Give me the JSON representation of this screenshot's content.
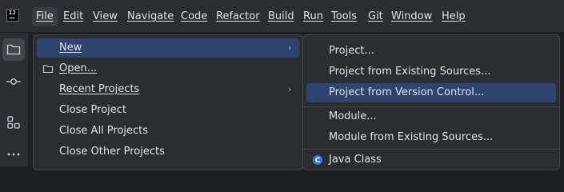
{
  "menubar": {
    "items": [
      "File",
      "Edit",
      "View",
      "Navigate",
      "Code",
      "Refactor",
      "Build",
      "Run",
      "Tools",
      "Git",
      "Window",
      "Help"
    ],
    "active": "File"
  },
  "toolstrip": {
    "icons": [
      "project-folder-icon",
      "commit-icon",
      "structure-icon",
      "more-icon"
    ]
  },
  "file_menu": {
    "items": [
      {
        "label": "New",
        "has_submenu": true,
        "selected": true
      },
      {
        "label": "Open...",
        "icon": "folder-icon"
      },
      {
        "label": "Recent Projects",
        "has_submenu": true
      },
      {
        "label": "Close Project"
      },
      {
        "label": "Close All Projects"
      },
      {
        "label": "Close Other Projects"
      }
    ],
    "submenu_glyph": "›"
  },
  "new_submenu": {
    "items": [
      {
        "label": "Project..."
      },
      {
        "label": "Project from Existing Sources..."
      },
      {
        "label": "Project from Version Control...",
        "selected": true
      },
      {
        "label": "Module..."
      },
      {
        "label": "Module from Existing Sources..."
      },
      {
        "label": "Java Class",
        "icon": "java-class-icon"
      }
    ]
  },
  "colors": {
    "background": "#1e1f22",
    "panel": "#2b2d30",
    "selection": "#2e436e",
    "text": "#dfe1e5"
  }
}
